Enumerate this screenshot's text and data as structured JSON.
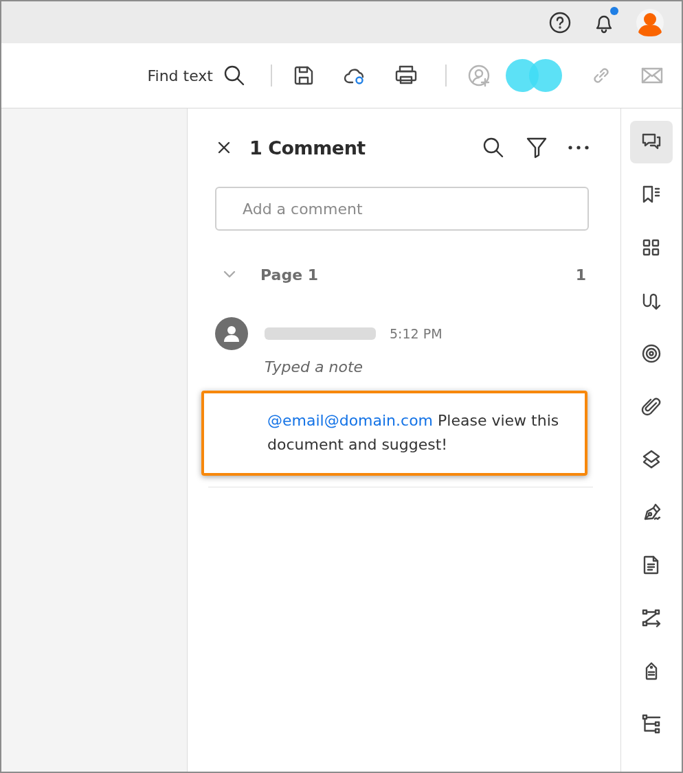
{
  "header": {
    "notifications_unread": true
  },
  "toolbar": {
    "find_label": "Find text",
    "items": [
      {
        "kind": "save"
      },
      {
        "kind": "cloud"
      },
      {
        "kind": "print"
      },
      {
        "kind": "divider"
      },
      {
        "kind": "share",
        "disabled": true
      },
      {
        "kind": "collaborators"
      },
      {
        "kind": "link",
        "disabled": true
      },
      {
        "kind": "mail",
        "disabled": true
      }
    ]
  },
  "comments_panel": {
    "title": "1 Comment",
    "input": {
      "placeholder": "Add a comment"
    },
    "groups": [
      {
        "label": "Page 1",
        "count": "1",
        "expanded": true,
        "comments": [
          {
            "time": "5:12 PM",
            "action": "Typed a note",
            "mention": "@email@domain.com",
            "text": "Please view this document and suggest!",
            "highlighted": true
          }
        ]
      }
    ]
  },
  "rail": [
    {
      "kind": "comments",
      "selected": true
    },
    {
      "kind": "bookmarks",
      "selected": false
    },
    {
      "kind": "thumbnails",
      "selected": false
    },
    {
      "kind": "order",
      "selected": false
    },
    {
      "kind": "target",
      "selected": false
    },
    {
      "kind": "attachments",
      "selected": false
    },
    {
      "kind": "layers",
      "selected": false
    },
    {
      "kind": "sign",
      "selected": false
    },
    {
      "kind": "document",
      "selected": false
    },
    {
      "kind": "flow",
      "selected": false
    },
    {
      "kind": "tag",
      "selected": false
    },
    {
      "kind": "tree",
      "selected": false
    }
  ]
}
